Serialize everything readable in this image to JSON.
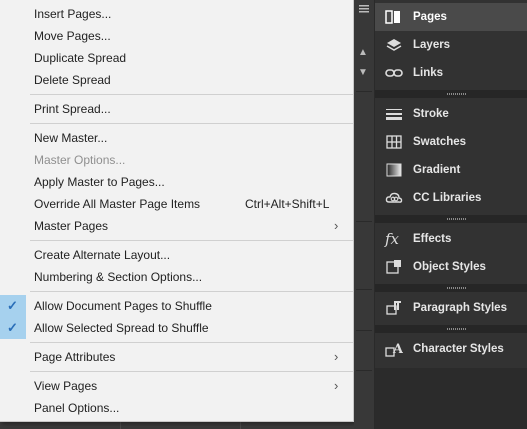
{
  "menu": {
    "items": [
      {
        "label": "Insert Pages...",
        "shortcut": "",
        "submenu": false,
        "checked": false,
        "disabled": false
      },
      {
        "label": "Move Pages...",
        "shortcut": "",
        "submenu": false,
        "checked": false,
        "disabled": false
      },
      {
        "label": "Duplicate Spread",
        "shortcut": "",
        "submenu": false,
        "checked": false,
        "disabled": false
      },
      {
        "label": "Delete Spread",
        "shortcut": "",
        "submenu": false,
        "checked": false,
        "disabled": false
      },
      {
        "label": "Print Spread...",
        "shortcut": "",
        "submenu": false,
        "checked": false,
        "disabled": false
      },
      {
        "label": "New Master...",
        "shortcut": "",
        "submenu": false,
        "checked": false,
        "disabled": false
      },
      {
        "label": "Master Options...",
        "shortcut": "",
        "submenu": false,
        "checked": false,
        "disabled": true
      },
      {
        "label": "Apply Master to Pages...",
        "shortcut": "",
        "submenu": false,
        "checked": false,
        "disabled": false
      },
      {
        "label": "Override All Master Page Items",
        "shortcut": "Ctrl+Alt+Shift+L",
        "submenu": false,
        "checked": false,
        "disabled": false
      },
      {
        "label": "Master Pages",
        "shortcut": "",
        "submenu": true,
        "checked": false,
        "disabled": false
      },
      {
        "label": "Create Alternate Layout...",
        "shortcut": "",
        "submenu": false,
        "checked": false,
        "disabled": false
      },
      {
        "label": "Numbering & Section Options...",
        "shortcut": "",
        "submenu": false,
        "checked": false,
        "disabled": false
      },
      {
        "label": "Allow Document Pages to Shuffle",
        "shortcut": "",
        "submenu": false,
        "checked": true,
        "disabled": false
      },
      {
        "label": "Allow Selected Spread to Shuffle",
        "shortcut": "",
        "submenu": false,
        "checked": true,
        "disabled": false
      },
      {
        "label": "Page Attributes",
        "shortcut": "",
        "submenu": true,
        "checked": false,
        "disabled": false
      },
      {
        "label": "View Pages",
        "shortcut": "",
        "submenu": true,
        "checked": false,
        "disabled": false
      },
      {
        "label": "Panel Options...",
        "shortcut": "",
        "submenu": false,
        "checked": false,
        "disabled": false
      }
    ]
  },
  "panels": {
    "items": [
      {
        "label": "Pages",
        "icon": "pages-icon",
        "active": true
      },
      {
        "label": "Layers",
        "icon": "layers-icon",
        "active": false
      },
      {
        "label": "Links",
        "icon": "links-icon",
        "active": false
      },
      {
        "label": "Stroke",
        "icon": "stroke-icon",
        "active": false
      },
      {
        "label": "Swatches",
        "icon": "swatches-icon",
        "active": false
      },
      {
        "label": "Gradient",
        "icon": "gradient-icon",
        "active": false
      },
      {
        "label": "CC Libraries",
        "icon": "cc-libraries-icon",
        "active": false
      },
      {
        "label": "Effects",
        "icon": "effects-icon",
        "active": false
      },
      {
        "label": "Object Styles",
        "icon": "object-styles-icon",
        "active": false
      },
      {
        "label": "Paragraph Styles",
        "icon": "paragraph-styles-icon",
        "active": false
      },
      {
        "label": "Character Styles",
        "icon": "character-styles-icon",
        "active": false
      }
    ]
  },
  "glyphs": {
    "submenu_arrow": "›",
    "check": "✓",
    "scroll_up": "▲",
    "scroll_down": "▼",
    "effects": "fx",
    "character": "A"
  },
  "colors": {
    "menu_bg": "#f2f2f2",
    "check_column": "#a6d1ee",
    "checkmark": "#2a6eb8",
    "dock_bg": "#323232",
    "active_panel": "#4a4a4a"
  }
}
